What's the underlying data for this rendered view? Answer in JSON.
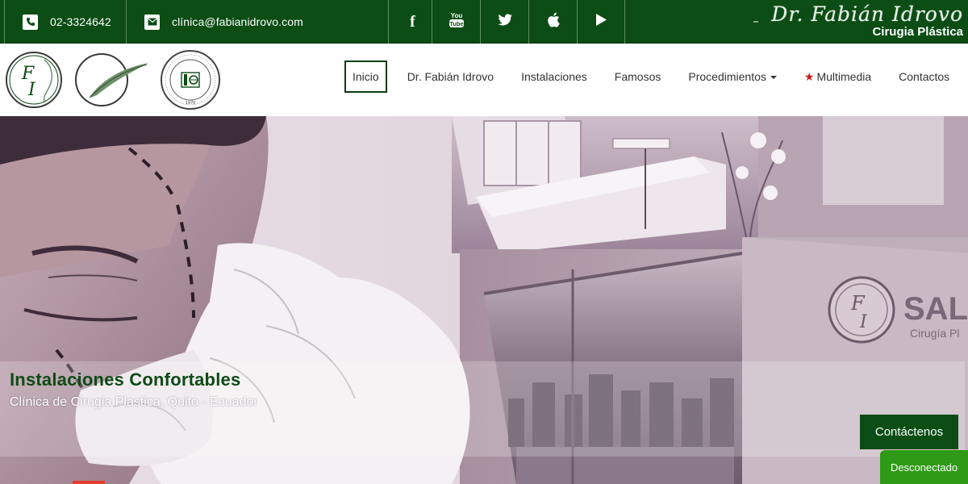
{
  "topbar": {
    "phone": "02-3324642",
    "email": "clínica@fabianidrovo.com",
    "social": [
      {
        "name": "facebook-icon",
        "glyph": "f"
      },
      {
        "name": "youtube-icon",
        "glyph": "You Tube"
      },
      {
        "name": "twitter-icon",
        "glyph": ""
      },
      {
        "name": "apple-icon",
        "glyph": ""
      },
      {
        "name": "play-icon",
        "glyph": "▶"
      }
    ],
    "brand_signature": "Dr. Fabián Idrovo",
    "brand_subtitle": "Cirugia Plástica"
  },
  "nav": {
    "items": [
      {
        "label": "Inicio",
        "active": true
      },
      {
        "label": "Dr. Fabián Idrovo"
      },
      {
        "label": "Instalaciones"
      },
      {
        "label": "Famosos"
      },
      {
        "label": "Procedimientos",
        "dropdown": true
      },
      {
        "label": "Multimedia",
        "starred": true
      },
      {
        "label": "Contactos"
      }
    ],
    "logo1_text": "FI"
  },
  "hero": {
    "title": "Instalaciones Confortables",
    "subtitle": "Clínica de Cirugia Plastica, Quito - Ecuador",
    "cta": "Contáctenos",
    "sign_text": "SAL",
    "sign_sub": "Cirugía Pl"
  },
  "status": {
    "label": "Desconectado"
  },
  "colors": {
    "primary": "#0b4d14",
    "accent_red": "#d8131b",
    "status_green": "#2e9a16"
  }
}
